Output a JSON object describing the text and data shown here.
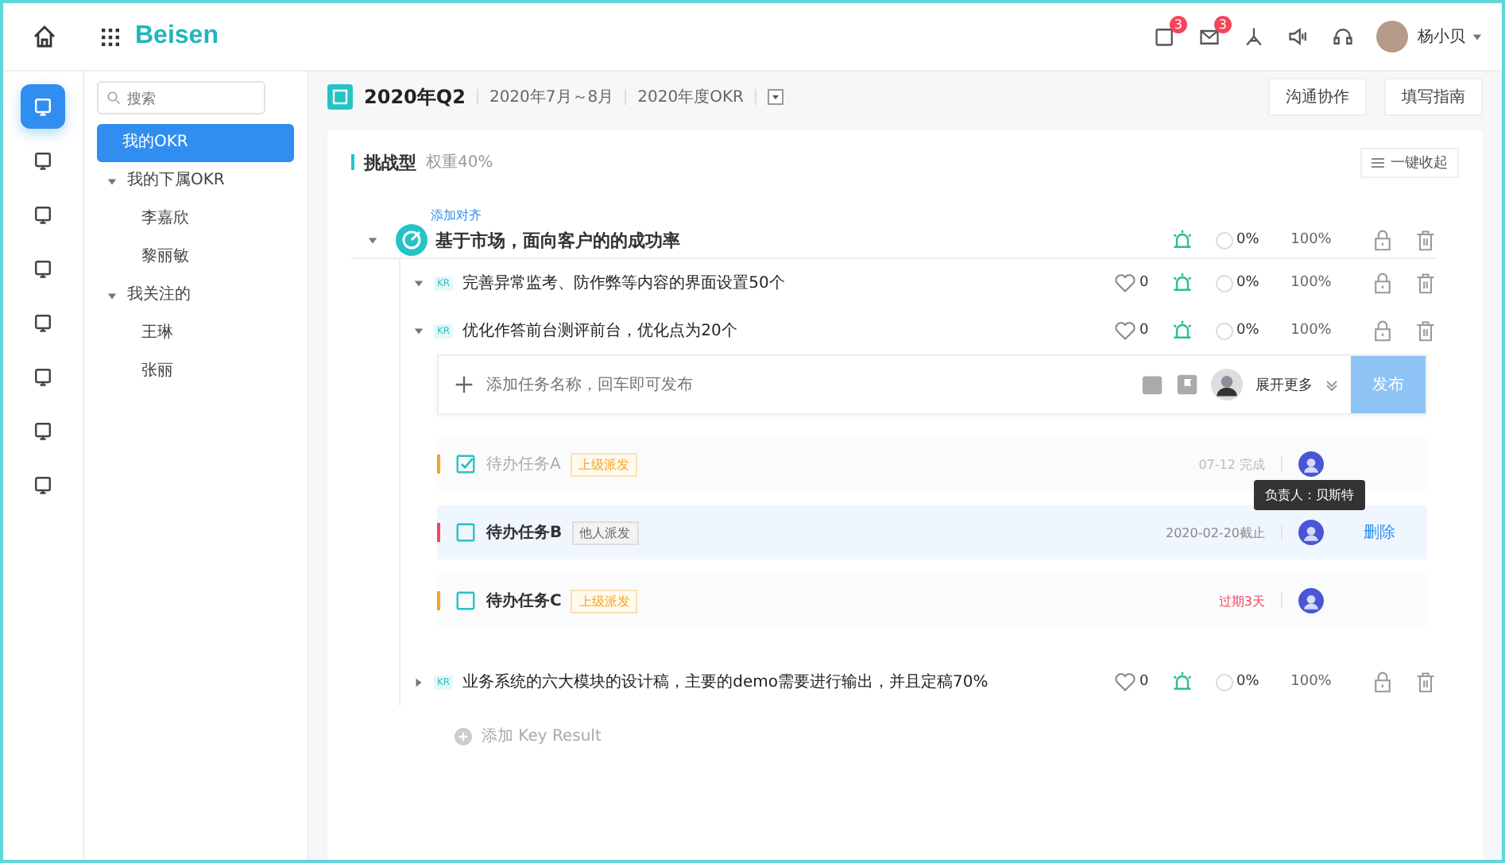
{
  "topbar": {
    "logo": "Beisen",
    "badges": [
      "3",
      "3"
    ],
    "user": "杨小贝"
  },
  "rail": [
    {
      "selected": true
    },
    {
      "selected": false
    },
    {
      "selected": false
    },
    {
      "selected": false
    },
    {
      "selected": false
    },
    {
      "selected": false
    },
    {
      "selected": false
    },
    {
      "selected": false
    }
  ],
  "sidebar": {
    "search": {
      "placeholder": "搜索"
    },
    "items": [
      {
        "label": "我的OKR",
        "selected": true
      },
      {
        "label": "我的下属OKR",
        "selected": false,
        "expanded": true,
        "children": [
          {
            "label": "李嘉欣",
            "selected": false
          },
          {
            "label": "黎丽敏",
            "selected": false
          }
        ]
      },
      {
        "label": "我关注的",
        "selected": false,
        "expanded": true,
        "children": [
          {
            "label": "王琳",
            "selected": false
          },
          {
            "label": "张丽",
            "selected": false
          }
        ]
      }
    ]
  },
  "header": {
    "quarter": "2020年Q2",
    "range": "2020年7月～8月",
    "cycle": "2020年度OKR",
    "buttons": [
      "沟通协作",
      "填写指南"
    ]
  },
  "group": {
    "title": "挑战型",
    "weight": "权重40%",
    "collapse": "一键收起"
  },
  "objective": {
    "align": "添加对齐",
    "title": "基于市场，面向客户的的成功率",
    "expanded": true,
    "progress": "0%",
    "score": "100%"
  },
  "key_results": [
    {
      "badge": "KR",
      "title": "完善异常监考、防作弊等内容的界面设置50个",
      "expanded": true,
      "likes": "0",
      "progress": "0%",
      "score": "100%"
    },
    {
      "badge": "KR",
      "title": "优化作答前台测评前台，优化点为20个",
      "expanded": true,
      "likes": "0",
      "progress": "0%",
      "score": "100%",
      "composer": {
        "placeholder": "添加任务名称，回车即可发布",
        "more": "展开更多",
        "publish": "发布"
      },
      "tasks": [
        {
          "title": "待办任务A",
          "checked": true,
          "color": "#f5a623",
          "tag": "上级派发",
          "from_superior": true,
          "date": "07-12 完成",
          "overdue": false,
          "highlighted": false
        },
        {
          "title": "待办任务B",
          "checked": false,
          "color": "#f5455c",
          "tag": "他人派发",
          "from_superior": false,
          "date": "2020-02-20截止",
          "overdue": false,
          "highlighted": true,
          "tooltip": "负责人：贝斯特",
          "action": "删除"
        },
        {
          "title": "待办任务C",
          "checked": false,
          "color": "#f5a623",
          "tag": "上级派发",
          "from_superior": true,
          "date": "过期3天",
          "overdue": true,
          "highlighted": false
        }
      ]
    },
    {
      "badge": "KR",
      "title": "业务系统的六大模块的设计稿，主要的demo需要进行输出，并且定稿70%",
      "expanded": false,
      "likes": "0",
      "progress": "0%",
      "score": "100%"
    }
  ],
  "add_kr": "添加 Key Result"
}
